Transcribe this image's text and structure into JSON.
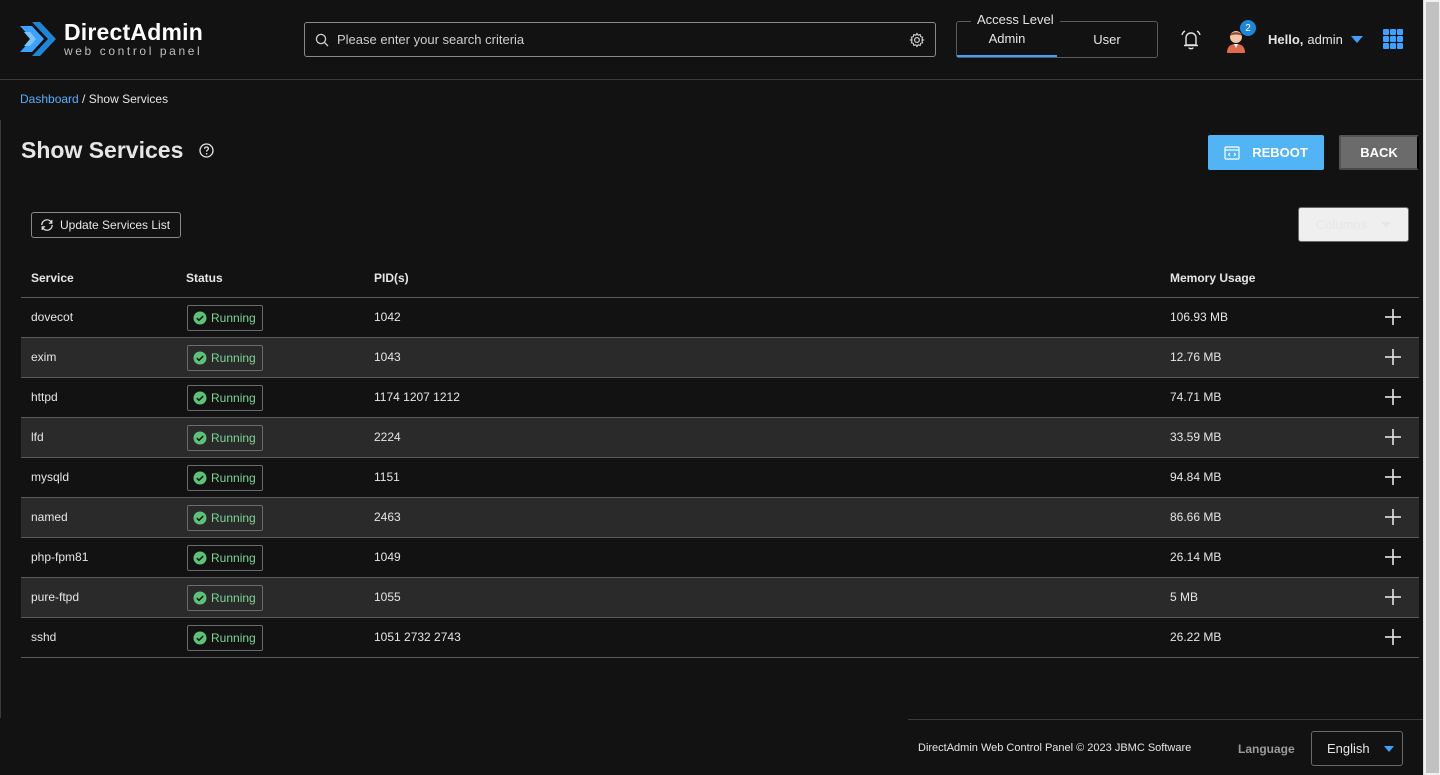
{
  "brand": {
    "name": "DirectAdmin",
    "tagline": "web control panel",
    "accent": "#3ea1ff"
  },
  "header": {
    "search_placeholder": "Please enter your search criteria",
    "access_level": {
      "legend": "Access Level",
      "tabs": [
        "Admin",
        "User"
      ],
      "active": "Admin"
    },
    "notifications_count": "2",
    "greeting": "Hello,",
    "username": "admin"
  },
  "breadcrumb": {
    "root": "Dashboard",
    "separator": " / ",
    "current": "Show Services"
  },
  "page": {
    "title": "Show Services",
    "reboot_label": "REBOOT",
    "back_label": "BACK",
    "update_label": "Update Services List",
    "columns_label": "Columns"
  },
  "table": {
    "headers": {
      "service": "Service",
      "status": "Status",
      "pids": "PID(s)",
      "memory": "Memory Usage"
    },
    "rows": [
      {
        "service": "dovecot",
        "status": "Running",
        "pids": "1042",
        "memory": "106.93 MB"
      },
      {
        "service": "exim",
        "status": "Running",
        "pids": "1043",
        "memory": "12.76 MB"
      },
      {
        "service": "httpd",
        "status": "Running",
        "pids": "1174 1207 1212",
        "memory": "74.71 MB"
      },
      {
        "service": "lfd",
        "status": "Running",
        "pids": "2224",
        "memory": "33.59 MB"
      },
      {
        "service": "mysqld",
        "status": "Running",
        "pids": "1151",
        "memory": "94.84 MB"
      },
      {
        "service": "named",
        "status": "Running",
        "pids": "2463",
        "memory": "86.66 MB"
      },
      {
        "service": "php-fpm81",
        "status": "Running",
        "pids": "1049",
        "memory": "26.14 MB"
      },
      {
        "service": "pure-ftpd",
        "status": "Running",
        "pids": "1055",
        "memory": "5 MB"
      },
      {
        "service": "sshd",
        "status": "Running",
        "pids": "1051 2732 2743",
        "memory": "26.22 MB"
      }
    ]
  },
  "footer": {
    "copyright": "DirectAdmin Web Control Panel © 2023 JBMC Software",
    "language_label": "Language",
    "language_value": "English"
  }
}
